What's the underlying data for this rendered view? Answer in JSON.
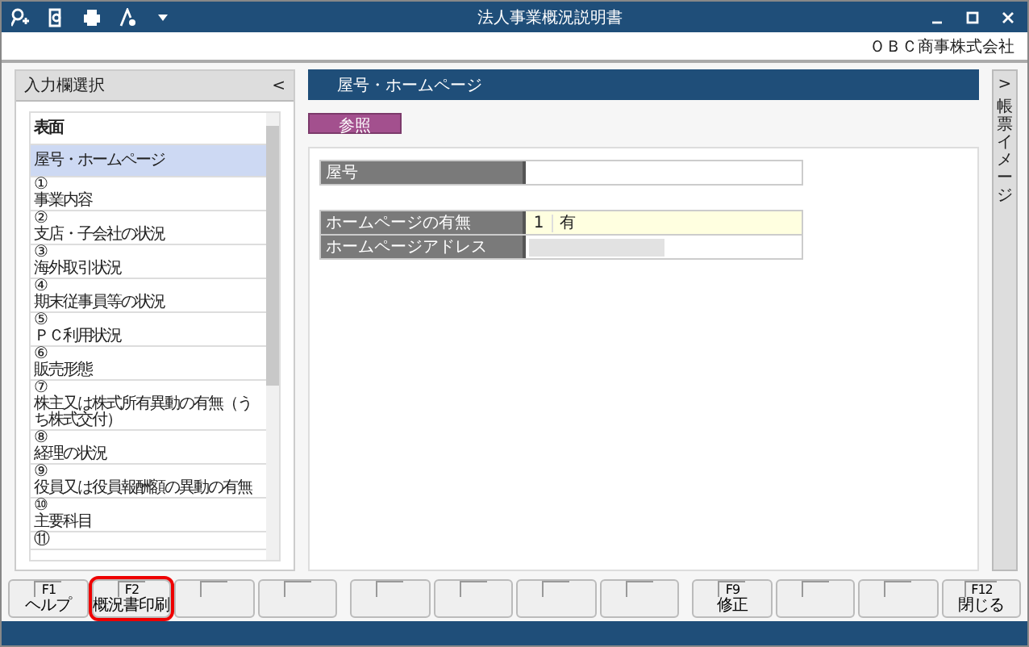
{
  "window": {
    "title": "法人事業概況説明書"
  },
  "company": "ＯＢＣ商事株式会社",
  "sidebar": {
    "title": "入力欄選択",
    "collapse": "<",
    "items": [
      {
        "kind": "header",
        "label": "表面",
        "selected": false
      },
      {
        "kind": "item",
        "label": "屋号・ホームページ",
        "selected": true
      },
      {
        "kind": "item",
        "number": "①",
        "label": "事業内容",
        "selected": false
      },
      {
        "kind": "item",
        "number": "②",
        "label": "支店・子会社の状況",
        "selected": false
      },
      {
        "kind": "item",
        "number": "③",
        "label": "海外取引状況",
        "selected": false
      },
      {
        "kind": "item",
        "number": "④",
        "label": "期末従事員等の状況",
        "selected": false
      },
      {
        "kind": "item",
        "number": "⑤",
        "label": "ＰＣ利用状況",
        "selected": false
      },
      {
        "kind": "item",
        "number": "⑥",
        "label": "販売形態",
        "selected": false
      },
      {
        "kind": "item",
        "number": "⑦",
        "label": "株主又は株式所有異動の有無（うち株式交付）",
        "selected": false
      },
      {
        "kind": "item",
        "number": "⑧",
        "label": "経理の状況",
        "selected": false
      },
      {
        "kind": "item",
        "number": "⑨",
        "label": "役員又は役員報酬額の異動の有無",
        "selected": false
      },
      {
        "kind": "item",
        "number": "⑩",
        "label": "主要科目",
        "selected": false
      },
      {
        "kind": "item",
        "number": "⑪",
        "selected": false
      }
    ]
  },
  "content": {
    "title": "屋号・ホームページ",
    "mode_button": "参照",
    "groups": [
      [
        {
          "label": "屋号",
          "kind": "text"
        }
      ],
      [
        {
          "label": "ホームページの有無",
          "kind": "choice",
          "code": "1",
          "value": "有"
        },
        {
          "label": "ホームページアドレス",
          "kind": "masked"
        }
      ]
    ]
  },
  "side_tab": {
    "arrow": ">",
    "label": "帳票イメージ"
  },
  "function_keys": [
    {
      "key": "F1",
      "label": "ヘルプ",
      "highlighted": false
    },
    {
      "key": "F2",
      "label": "概況書印刷",
      "highlighted": true
    },
    {
      "highlighted": false
    },
    {
      "highlighted": false
    },
    {
      "highlighted": false
    },
    {
      "highlighted": false
    },
    {
      "highlighted": false
    },
    {
      "highlighted": false
    },
    {
      "key": "F9",
      "label": "修正",
      "highlighted": false
    },
    {
      "highlighted": false
    },
    {
      "highlighted": false
    },
    {
      "key": "F12",
      "label": "閉じる",
      "highlighted": false
    }
  ]
}
